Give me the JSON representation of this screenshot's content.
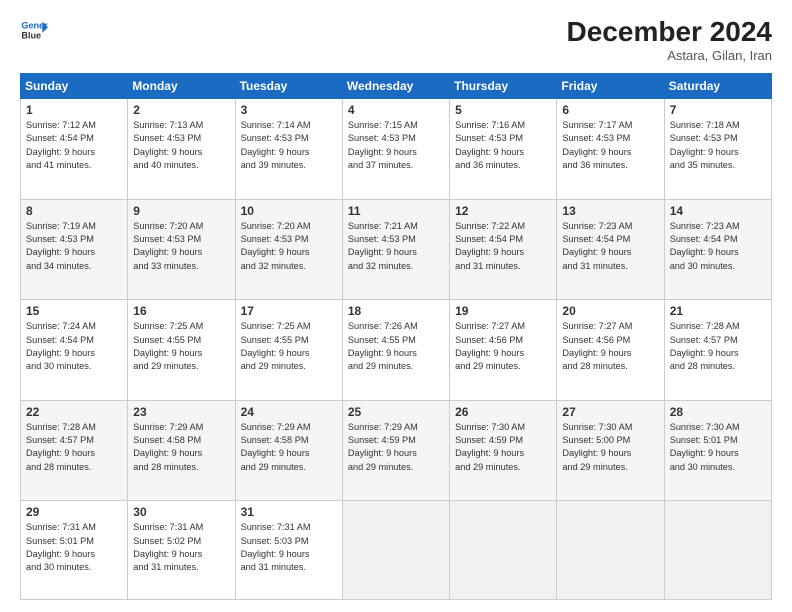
{
  "logo": {
    "line1": "General",
    "line2": "Blue"
  },
  "title": "December 2024",
  "location": "Astara, Gilan, Iran",
  "days_header": [
    "Sunday",
    "Monday",
    "Tuesday",
    "Wednesday",
    "Thursday",
    "Friday",
    "Saturday"
  ],
  "weeks": [
    [
      {
        "day": "1",
        "info": "Sunrise: 7:12 AM\nSunset: 4:54 PM\nDaylight: 9 hours\nand 41 minutes."
      },
      {
        "day": "2",
        "info": "Sunrise: 7:13 AM\nSunset: 4:53 PM\nDaylight: 9 hours\nand 40 minutes."
      },
      {
        "day": "3",
        "info": "Sunrise: 7:14 AM\nSunset: 4:53 PM\nDaylight: 9 hours\nand 39 minutes."
      },
      {
        "day": "4",
        "info": "Sunrise: 7:15 AM\nSunset: 4:53 PM\nDaylight: 9 hours\nand 37 minutes."
      },
      {
        "day": "5",
        "info": "Sunrise: 7:16 AM\nSunset: 4:53 PM\nDaylight: 9 hours\nand 36 minutes."
      },
      {
        "day": "6",
        "info": "Sunrise: 7:17 AM\nSunset: 4:53 PM\nDaylight: 9 hours\nand 36 minutes."
      },
      {
        "day": "7",
        "info": "Sunrise: 7:18 AM\nSunset: 4:53 PM\nDaylight: 9 hours\nand 35 minutes."
      }
    ],
    [
      {
        "day": "8",
        "info": "Sunrise: 7:19 AM\nSunset: 4:53 PM\nDaylight: 9 hours\nand 34 minutes."
      },
      {
        "day": "9",
        "info": "Sunrise: 7:20 AM\nSunset: 4:53 PM\nDaylight: 9 hours\nand 33 minutes."
      },
      {
        "day": "10",
        "info": "Sunrise: 7:20 AM\nSunset: 4:53 PM\nDaylight: 9 hours\nand 32 minutes."
      },
      {
        "day": "11",
        "info": "Sunrise: 7:21 AM\nSunset: 4:53 PM\nDaylight: 9 hours\nand 32 minutes."
      },
      {
        "day": "12",
        "info": "Sunrise: 7:22 AM\nSunset: 4:54 PM\nDaylight: 9 hours\nand 31 minutes."
      },
      {
        "day": "13",
        "info": "Sunrise: 7:23 AM\nSunset: 4:54 PM\nDaylight: 9 hours\nand 31 minutes."
      },
      {
        "day": "14",
        "info": "Sunrise: 7:23 AM\nSunset: 4:54 PM\nDaylight: 9 hours\nand 30 minutes."
      }
    ],
    [
      {
        "day": "15",
        "info": "Sunrise: 7:24 AM\nSunset: 4:54 PM\nDaylight: 9 hours\nand 30 minutes."
      },
      {
        "day": "16",
        "info": "Sunrise: 7:25 AM\nSunset: 4:55 PM\nDaylight: 9 hours\nand 29 minutes."
      },
      {
        "day": "17",
        "info": "Sunrise: 7:25 AM\nSunset: 4:55 PM\nDaylight: 9 hours\nand 29 minutes."
      },
      {
        "day": "18",
        "info": "Sunrise: 7:26 AM\nSunset: 4:55 PM\nDaylight: 9 hours\nand 29 minutes."
      },
      {
        "day": "19",
        "info": "Sunrise: 7:27 AM\nSunset: 4:56 PM\nDaylight: 9 hours\nand 29 minutes."
      },
      {
        "day": "20",
        "info": "Sunrise: 7:27 AM\nSunset: 4:56 PM\nDaylight: 9 hours\nand 28 minutes."
      },
      {
        "day": "21",
        "info": "Sunrise: 7:28 AM\nSunset: 4:57 PM\nDaylight: 9 hours\nand 28 minutes."
      }
    ],
    [
      {
        "day": "22",
        "info": "Sunrise: 7:28 AM\nSunset: 4:57 PM\nDaylight: 9 hours\nand 28 minutes."
      },
      {
        "day": "23",
        "info": "Sunrise: 7:29 AM\nSunset: 4:58 PM\nDaylight: 9 hours\nand 28 minutes."
      },
      {
        "day": "24",
        "info": "Sunrise: 7:29 AM\nSunset: 4:58 PM\nDaylight: 9 hours\nand 29 minutes."
      },
      {
        "day": "25",
        "info": "Sunrise: 7:29 AM\nSunset: 4:59 PM\nDaylight: 9 hours\nand 29 minutes."
      },
      {
        "day": "26",
        "info": "Sunrise: 7:30 AM\nSunset: 4:59 PM\nDaylight: 9 hours\nand 29 minutes."
      },
      {
        "day": "27",
        "info": "Sunrise: 7:30 AM\nSunset: 5:00 PM\nDaylight: 9 hours\nand 29 minutes."
      },
      {
        "day": "28",
        "info": "Sunrise: 7:30 AM\nSunset: 5:01 PM\nDaylight: 9 hours\nand 30 minutes."
      }
    ],
    [
      {
        "day": "29",
        "info": "Sunrise: 7:31 AM\nSunset: 5:01 PM\nDaylight: 9 hours\nand 30 minutes."
      },
      {
        "day": "30",
        "info": "Sunrise: 7:31 AM\nSunset: 5:02 PM\nDaylight: 9 hours\nand 31 minutes."
      },
      {
        "day": "31",
        "info": "Sunrise: 7:31 AM\nSunset: 5:03 PM\nDaylight: 9 hours\nand 31 minutes."
      },
      {
        "day": "",
        "info": ""
      },
      {
        "day": "",
        "info": ""
      },
      {
        "day": "",
        "info": ""
      },
      {
        "day": "",
        "info": ""
      }
    ]
  ]
}
